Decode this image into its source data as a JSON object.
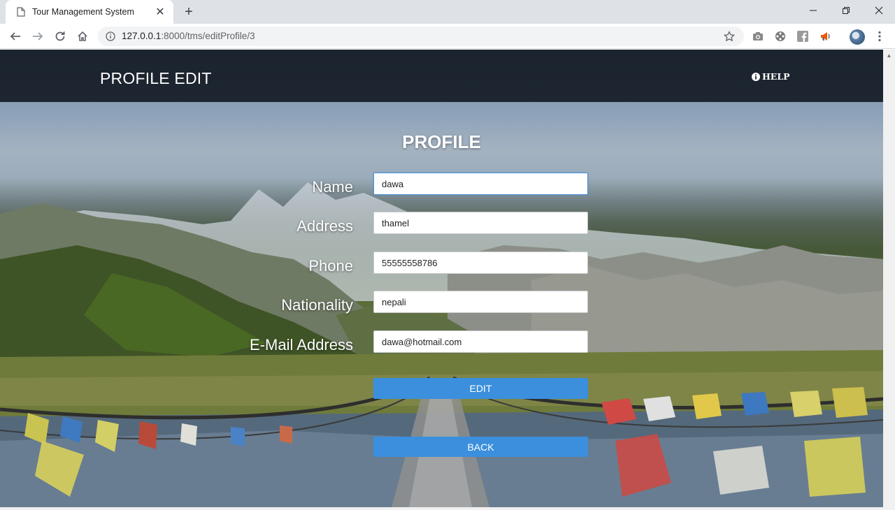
{
  "browser": {
    "tab": {
      "title": "Tour Management System",
      "close_glyph": "✕",
      "favicon": "page-icon"
    },
    "new_tab_glyph": "+",
    "window_controls": {
      "minimize": "minimize-icon",
      "maximize": "restore-icon",
      "close": "close-icon"
    },
    "url": {
      "host": "127.0.0.1",
      "rest": ":8000/tms/editProfile/3"
    },
    "extensions": [
      "camera-icon",
      "film-reel-icon",
      "facebook-icon",
      "megaphone-icon"
    ]
  },
  "page": {
    "header": {
      "title": "PROFILE EDIT",
      "help_label": "HELP"
    },
    "heading": "PROFILE",
    "form": {
      "fields": [
        {
          "label": "Name",
          "value": "dawa"
        },
        {
          "label": "Address",
          "value": "thamel"
        },
        {
          "label": "Phone",
          "value": "55555558786"
        },
        {
          "label": "Nationality",
          "value": "nepali"
        },
        {
          "label": "E-Mail Address",
          "value": "dawa@hotmail.com"
        }
      ],
      "edit_label": "EDIT",
      "back_label": "BACK"
    }
  },
  "colors": {
    "header_bg": "#0f161e",
    "button": "#3b8fdd",
    "tabstrip": "#dee1e6"
  }
}
